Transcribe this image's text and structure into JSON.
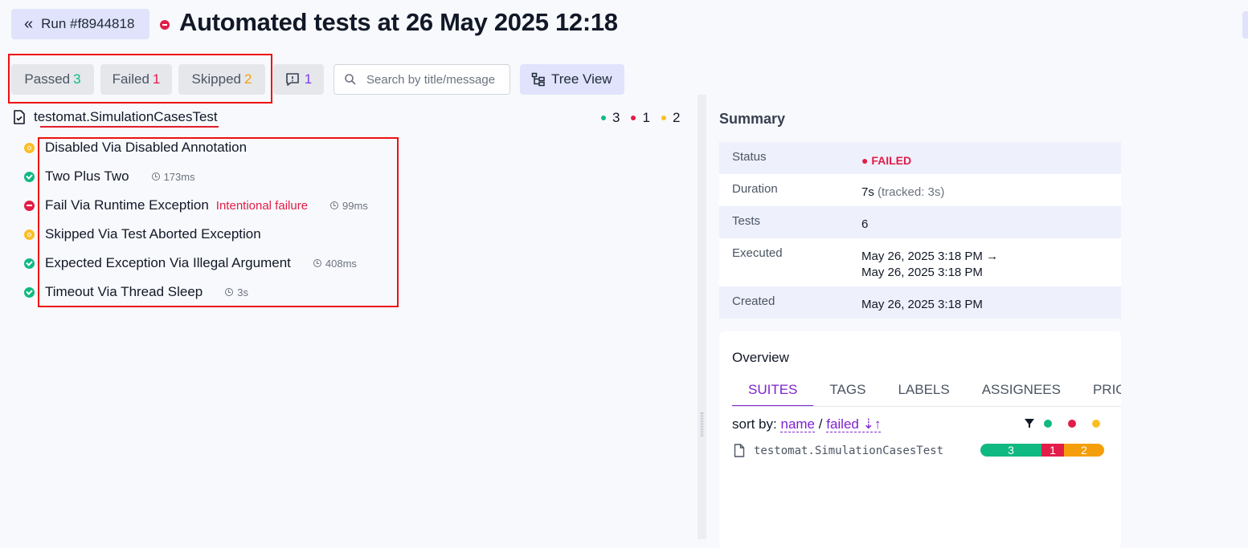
{
  "header": {
    "run_label": "Run #f8944818",
    "title": "Automated tests at 26 May 2025 12:18",
    "status_color": "#e11d48"
  },
  "toolbar": {
    "filters": [
      {
        "label": "Passed",
        "count": "3",
        "color": "#10b981"
      },
      {
        "label": "Failed",
        "count": "1",
        "color": "#e11d48"
      },
      {
        "label": "Skipped",
        "count": "2",
        "color": "#f59e0b"
      }
    ],
    "messages_count": "1",
    "search_placeholder": "Search by title/message",
    "view_label": "Tree View"
  },
  "suite": {
    "name": "testomat.SimulationCasesTest",
    "passed": "3",
    "failed": "1",
    "skipped": "2"
  },
  "tests": [
    {
      "title": "Disabled Via Disabled Annotation",
      "status": "skipped",
      "message": "",
      "time": ""
    },
    {
      "title": "Two Plus Two",
      "status": "passed",
      "message": "",
      "time": "173ms"
    },
    {
      "title": "Fail Via Runtime Exception",
      "status": "failed",
      "message": "Intentional failure",
      "time": "99ms"
    },
    {
      "title": "Skipped Via Test Aborted Exception",
      "status": "skipped",
      "message": "",
      "time": ""
    },
    {
      "title": "Expected Exception Via Illegal Argument",
      "status": "passed",
      "message": "",
      "time": "408ms"
    },
    {
      "title": "Timeout Via Thread Sleep",
      "status": "passed",
      "message": "",
      "time": "3s"
    }
  ],
  "summary": {
    "title": "Summary",
    "status_key": "Status",
    "status_val": "● FAILED",
    "duration_key": "Duration",
    "duration_val": "7s",
    "duration_tracked": "(tracked: 3s)",
    "tests_key": "Tests",
    "tests_val": "6",
    "executed_key": "Executed",
    "executed_start": "May 26, 2025 3:18 PM →",
    "executed_end": "May 26, 2025 3:18 PM",
    "created_key": "Created",
    "created_val": "May 26, 2025 3:18 PM"
  },
  "overview": {
    "title": "Overview",
    "tabs": [
      "SUITES",
      "TAGS",
      "LABELS",
      "ASSIGNEES",
      "PRIORITY"
    ],
    "active_tab": "SUITES",
    "sort_label": "sort by:",
    "sort_name": "name",
    "sort_sep": "/",
    "sort_failed": "failed",
    "sort_icon": "⇣↑",
    "suite_name": "testomat.SimulationCasesTest",
    "bar": {
      "passed": "3",
      "failed": "1",
      "skipped": "2"
    }
  },
  "colors": {
    "passed": "#10b981",
    "failed": "#e11d48",
    "skipped": "#fbbf24",
    "accent": "#7e22ce"
  }
}
